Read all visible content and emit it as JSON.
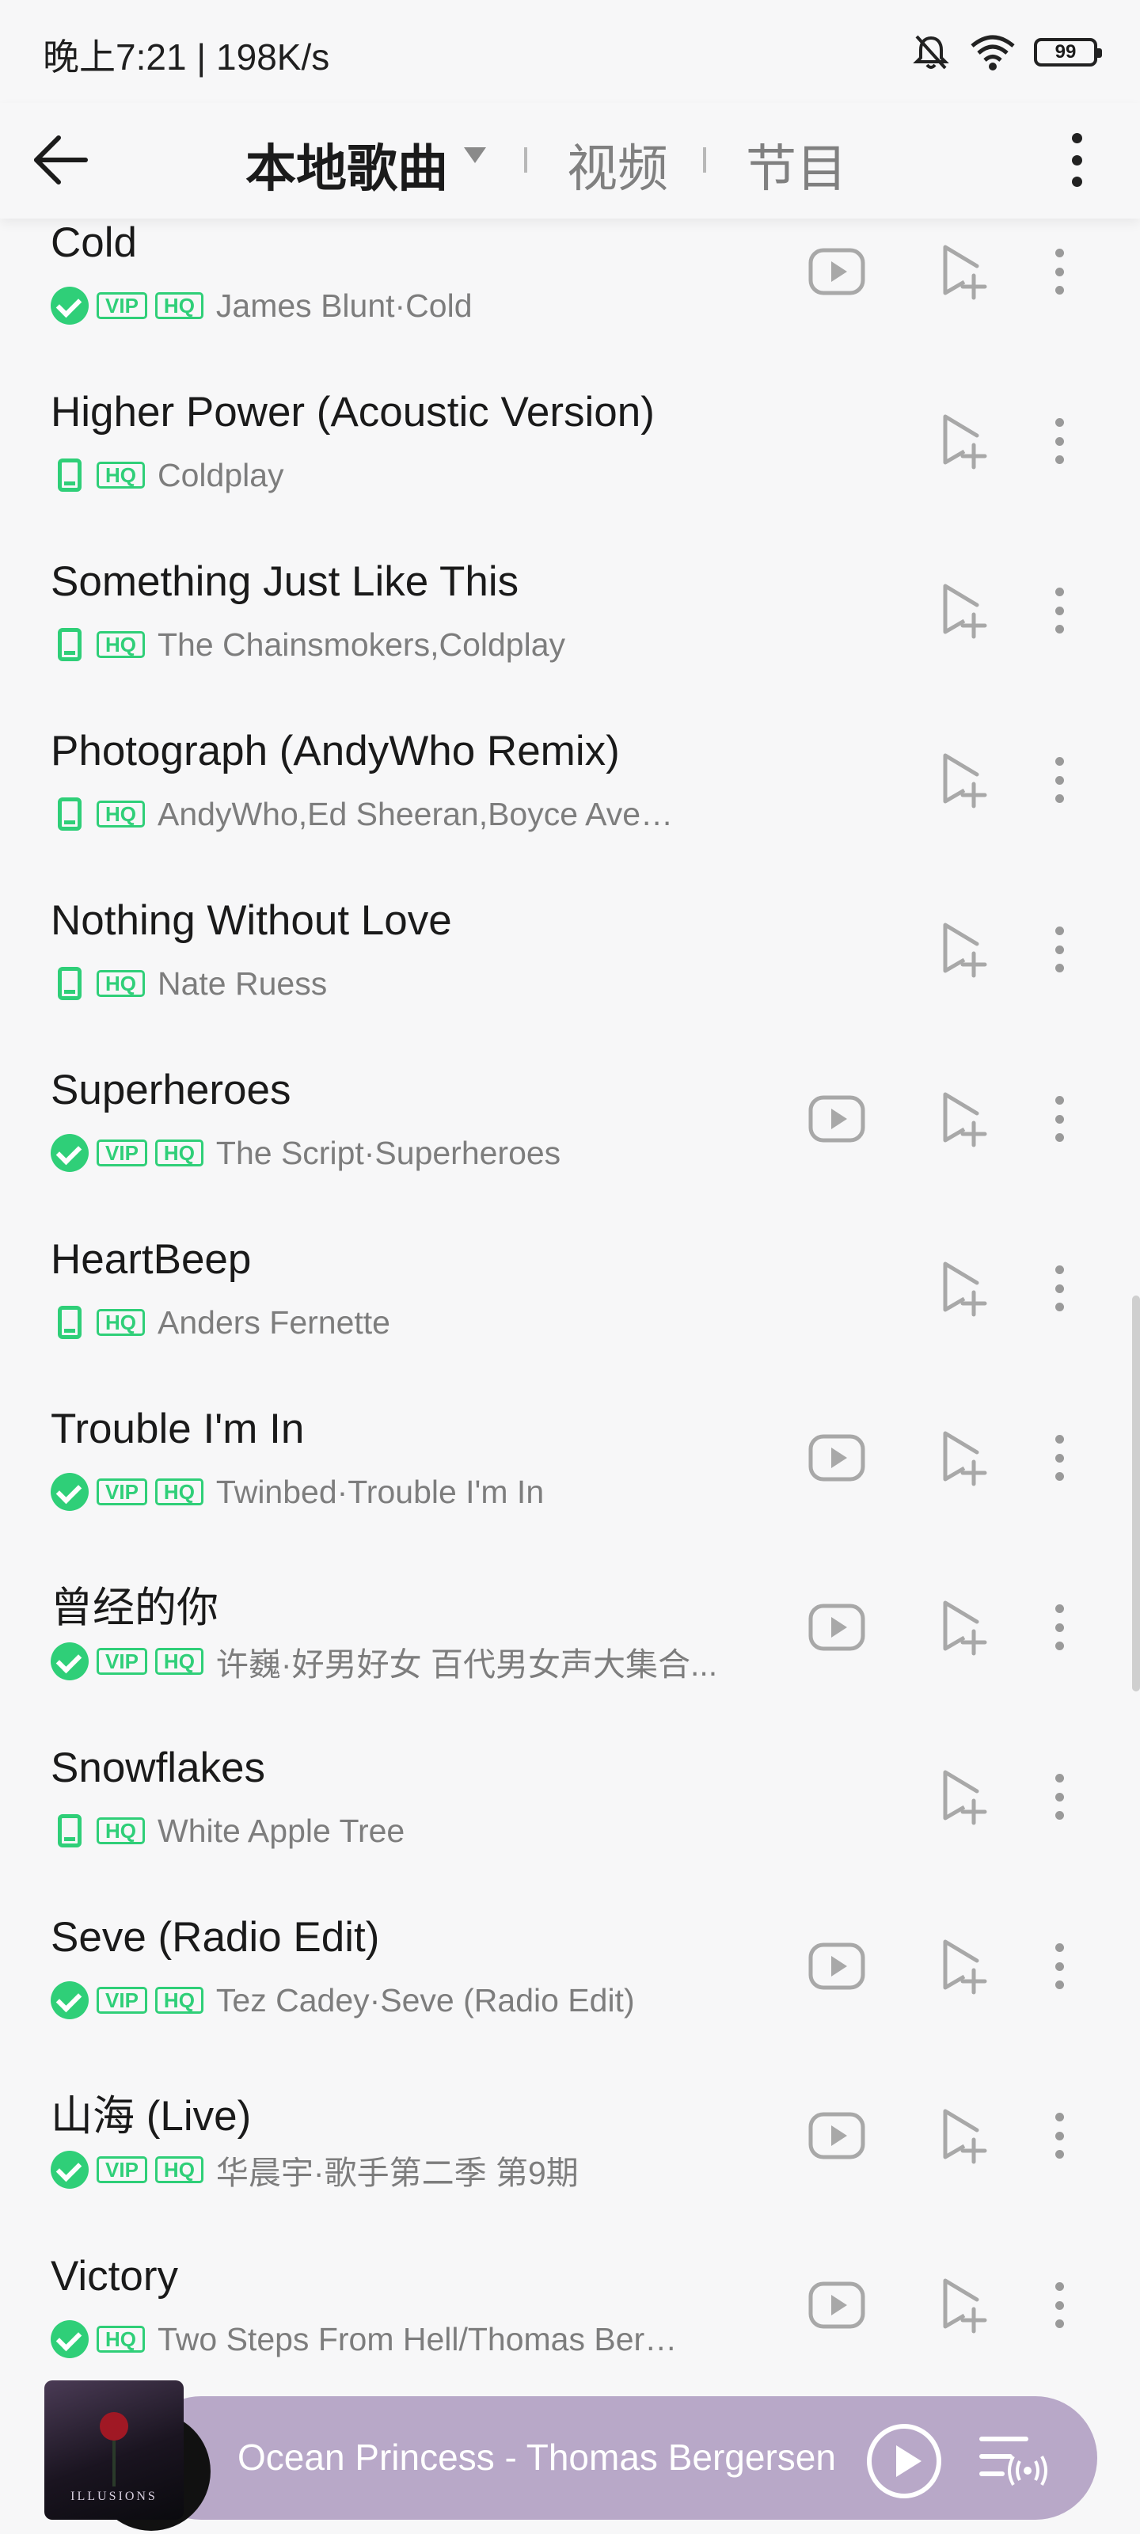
{
  "status_bar": {
    "time": "晚上7:21 | 198K/s",
    "battery": "99",
    "icons": [
      "bell-muted-icon",
      "wifi-icon",
      "battery-icon"
    ]
  },
  "header": {
    "tabs": [
      {
        "label": "本地歌曲",
        "active": true
      },
      {
        "label": "视频",
        "active": false
      },
      {
        "label": "节目",
        "active": false
      }
    ]
  },
  "colors": {
    "accent": "#2fcf78",
    "background": "#f7f7f8",
    "player": "#b8a8c8"
  },
  "songs": [
    {
      "title": "Cold",
      "downloaded": true,
      "vip": true,
      "hq": true,
      "artist": "James Blunt·Cold",
      "has_video": true
    },
    {
      "title": "Higher Power (Acoustic Version)",
      "downloaded": false,
      "vip": false,
      "hq": true,
      "artist": "Coldplay",
      "has_video": false
    },
    {
      "title": "Something Just Like This",
      "downloaded": false,
      "vip": false,
      "hq": true,
      "artist": "The Chainsmokers,Coldplay",
      "has_video": false
    },
    {
      "title": "Photograph (AndyWho Remix)",
      "downloaded": false,
      "vip": false,
      "hq": true,
      "artist": "AndyWho,Ed Sheeran,Boyce Avenue",
      "has_video": false
    },
    {
      "title": "Nothing Without Love",
      "downloaded": false,
      "vip": false,
      "hq": true,
      "artist": "Nate Ruess",
      "has_video": false
    },
    {
      "title": "Superheroes",
      "downloaded": true,
      "vip": true,
      "hq": true,
      "artist": "The Script·Superheroes",
      "has_video": true
    },
    {
      "title": "HeartBeep",
      "downloaded": false,
      "vip": false,
      "hq": true,
      "artist": "Anders Fernette",
      "has_video": false
    },
    {
      "title": "Trouble I'm In",
      "downloaded": true,
      "vip": true,
      "hq": true,
      "artist": "Twinbed·Trouble I'm In",
      "has_video": true
    },
    {
      "title": "曾经的你",
      "downloaded": true,
      "vip": true,
      "hq": true,
      "artist": "许巍·好男好女 百代男女声大集合...",
      "has_video": true
    },
    {
      "title": "Snowflakes",
      "downloaded": false,
      "vip": false,
      "hq": true,
      "artist": "White Apple Tree",
      "has_video": false
    },
    {
      "title": "Seve (Radio Edit)",
      "downloaded": true,
      "vip": true,
      "hq": true,
      "artist": "Tez Cadey·Seve (Radio Edit)",
      "has_video": true
    },
    {
      "title": "山海 (Live)",
      "downloaded": true,
      "vip": true,
      "hq": true,
      "artist": "华晨宇·歌手第二季 第9期",
      "has_video": true
    },
    {
      "title": "Victory",
      "downloaded": true,
      "vip": false,
      "hq": true,
      "artist": "Two Steps From Hell/Thomas Berger...",
      "has_video": true
    }
  ],
  "badges": {
    "vip": "VIP",
    "hq": "HQ"
  },
  "player": {
    "now_playing": "Ocean Princess - Thomas Bergersen",
    "cover_text": "ILLUSIONS"
  }
}
